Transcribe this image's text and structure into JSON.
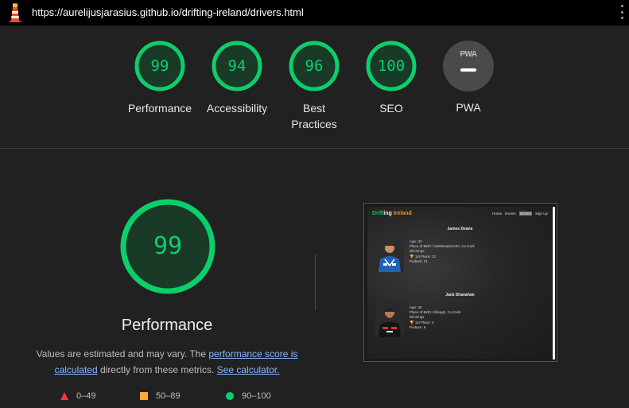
{
  "url": "https://aurelijusjarasius.github.io/drifting-ireland/drivers.html",
  "colors": {
    "pass": "#0cce6b",
    "average": "#ffaa33",
    "fail": "#ff3333",
    "link": "#8ab4f8"
  },
  "gauges": [
    {
      "score": 99,
      "label": "Performance"
    },
    {
      "score": 94,
      "label": "Accessibility"
    },
    {
      "score": 96,
      "label": "Best Practices"
    },
    {
      "score": 100,
      "label": "SEO"
    }
  ],
  "pwa": {
    "badge": "PWA",
    "label": "PWA"
  },
  "performance": {
    "score": 99,
    "title": "Performance",
    "desc_prefix": "Values are estimated and may vary. The ",
    "desc_link1": "performance score is calculated",
    "desc_mid": " directly from these metrics. ",
    "desc_link2": "See calculator."
  },
  "legend": [
    {
      "shape": "triangle",
      "range": "0–49"
    },
    {
      "shape": "square",
      "range": "50–89"
    },
    {
      "shape": "circle",
      "range": "90–100"
    }
  ],
  "thumbnail": {
    "logo_green": "Drift",
    "logo_white": "ing ",
    "logo_orange": "Ireland",
    "nav": [
      "Home",
      "Events",
      "Drivers",
      "Sign Up"
    ],
    "drivers": [
      {
        "name": "James Deane",
        "age": "Age: 33",
        "birth": "Place of Birth: Castletownroche, Co.Cork",
        "winnings": "Winnings",
        "first": "🏆 1st Place: 13",
        "podium": "Podium: 31"
      },
      {
        "name": "Jack Shanahan",
        "age": "Age: 25",
        "birth": "Place of Birth: Killeagh, Co.Cork",
        "winnings": "Winnings",
        "first": "🏆 1st Place: 4",
        "podium": "Podium: 9"
      }
    ]
  }
}
